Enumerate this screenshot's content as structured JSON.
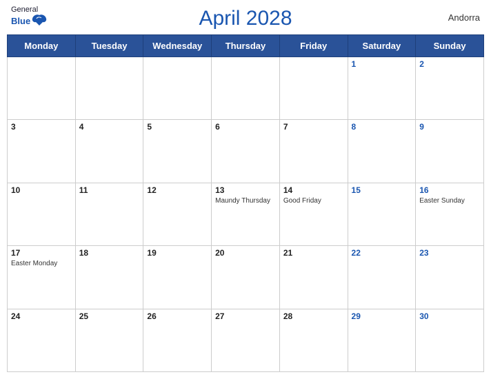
{
  "header": {
    "title": "April 2028",
    "region": "Andorra",
    "logo": {
      "general": "General",
      "blue": "Blue"
    }
  },
  "days_of_week": [
    "Monday",
    "Tuesday",
    "Wednesday",
    "Thursday",
    "Friday",
    "Saturday",
    "Sunday"
  ],
  "weeks": [
    [
      {
        "day": "",
        "holiday": ""
      },
      {
        "day": "",
        "holiday": ""
      },
      {
        "day": "",
        "holiday": ""
      },
      {
        "day": "",
        "holiday": ""
      },
      {
        "day": "",
        "holiday": ""
      },
      {
        "day": "1",
        "holiday": "",
        "weekend": true
      },
      {
        "day": "2",
        "holiday": "",
        "weekend": true
      }
    ],
    [
      {
        "day": "3",
        "holiday": ""
      },
      {
        "day": "4",
        "holiday": ""
      },
      {
        "day": "5",
        "holiday": ""
      },
      {
        "day": "6",
        "holiday": ""
      },
      {
        "day": "7",
        "holiday": ""
      },
      {
        "day": "8",
        "holiday": "",
        "weekend": true
      },
      {
        "day": "9",
        "holiday": "",
        "weekend": true
      }
    ],
    [
      {
        "day": "10",
        "holiday": ""
      },
      {
        "day": "11",
        "holiday": ""
      },
      {
        "day": "12",
        "holiday": ""
      },
      {
        "day": "13",
        "holiday": "Maundy Thursday"
      },
      {
        "day": "14",
        "holiday": "Good Friday"
      },
      {
        "day": "15",
        "holiday": "",
        "weekend": true
      },
      {
        "day": "16",
        "holiday": "Easter Sunday",
        "weekend": true
      }
    ],
    [
      {
        "day": "17",
        "holiday": "Easter Monday"
      },
      {
        "day": "18",
        "holiday": ""
      },
      {
        "day": "19",
        "holiday": ""
      },
      {
        "day": "20",
        "holiday": ""
      },
      {
        "day": "21",
        "holiday": ""
      },
      {
        "day": "22",
        "holiday": "",
        "weekend": true
      },
      {
        "day": "23",
        "holiday": "",
        "weekend": true
      }
    ],
    [
      {
        "day": "24",
        "holiday": ""
      },
      {
        "day": "25",
        "holiday": ""
      },
      {
        "day": "26",
        "holiday": ""
      },
      {
        "day": "27",
        "holiday": ""
      },
      {
        "day": "28",
        "holiday": ""
      },
      {
        "day": "29",
        "holiday": "",
        "weekend": true
      },
      {
        "day": "30",
        "holiday": "",
        "weekend": true
      }
    ]
  ]
}
